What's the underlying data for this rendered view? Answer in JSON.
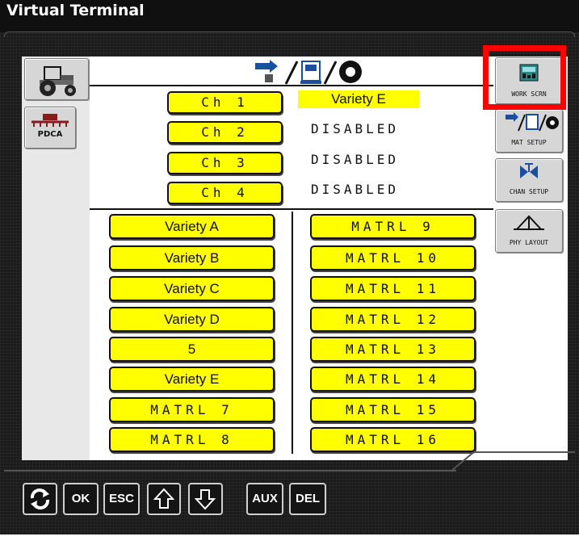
{
  "window": {
    "title": "Virtual Terminal"
  },
  "left_panel": {
    "pdca_label": "PDCA"
  },
  "softkeys": {
    "work_scrn": "WORK SCRN",
    "mat_setup": "MAT SETUP",
    "chan_setup": "CHAN SETUP",
    "phy_layout": "PHY LAYOUT"
  },
  "channels": [
    {
      "label": "Ch 1",
      "value": "Variety E"
    },
    {
      "label": "Ch 2",
      "value": "DISABLED"
    },
    {
      "label": "Ch 3",
      "value": "DISABLED"
    },
    {
      "label": "Ch 4",
      "value": "DISABLED"
    }
  ],
  "materials_left": [
    "Variety A",
    "Variety B",
    "Variety C",
    "Variety D",
    "5",
    "Variety E",
    "MATRL 7",
    "MATRL 8"
  ],
  "materials_right": [
    "MATRL 9",
    "MATRL 10",
    "MATRL 11",
    "MATRL 12",
    "MATRL 13",
    "MATRL 14",
    "MATRL 15",
    "MATRL 16"
  ],
  "hardkeys": {
    "ok": "OK",
    "esc": "ESC",
    "aux": "AUX",
    "del": "DEL"
  },
  "colors": {
    "pill": "#ffff00",
    "highlight": "#ff0000",
    "background": "#1b1b1b"
  }
}
